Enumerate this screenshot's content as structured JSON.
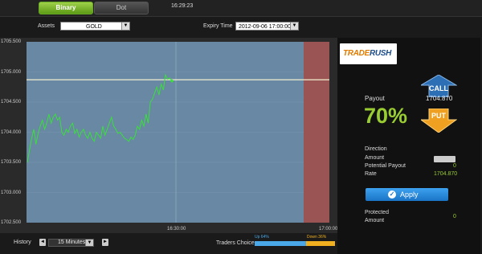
{
  "tabs": [
    {
      "label": "Binary",
      "active": true
    },
    {
      "label": "Dot",
      "active": false
    }
  ],
  "clock": "16:29:23",
  "filters": {
    "assets_label": "Assets",
    "asset_value": "GOLD",
    "expiry_label": "Expiry Time",
    "expiry_value": "2012-09-06 17:00:00"
  },
  "chart_data": {
    "type": "line",
    "y_ticks": [
      "1705.500",
      "1705.000",
      "1704.500",
      "1704.000",
      "1703.500",
      "1703.000",
      "1702.500"
    ],
    "x_ticks": [
      "16:30:00",
      "17:00:00"
    ],
    "ylim": [
      1702.5,
      1705.5
    ],
    "strike_price": 1704.87,
    "series": [
      {
        "values": [
          1703.5,
          1703.7,
          1703.9,
          1704.05,
          1703.8,
          1703.98,
          1704.1,
          1704.2,
          1704.05,
          1704.15,
          1704.3,
          1704.15,
          1704.25,
          1704.3,
          1704.2,
          1704.25,
          1704.0,
          1703.95,
          1704.05,
          1704.0,
          1704.1,
          1704.15,
          1703.98,
          1704.05,
          1703.92,
          1704.0,
          1704.05,
          1703.95,
          1703.9,
          1704.0,
          1703.9,
          1703.85,
          1704.0,
          1703.95,
          1703.9,
          1704.1,
          1703.95,
          1704.05,
          1704.15,
          1704.25,
          1704.1,
          1704.05,
          1703.98,
          1704.0,
          1703.95,
          1703.9,
          1703.88,
          1703.85,
          1703.92,
          1703.88,
          1703.95,
          1704.1,
          1704.05,
          1704.2,
          1704.1,
          1704.3,
          1704.15,
          1704.5,
          1704.55,
          1704.65,
          1704.75,
          1704.62,
          1704.8,
          1704.7,
          1704.95,
          1704.88,
          1704.9,
          1704.85
        ]
      }
    ]
  },
  "bottom": {
    "history_label": "History",
    "prev_arrow": "◄",
    "history_value": "15 Minutes",
    "next_arrow": "►",
    "traders_choice_label": "Traders Choice",
    "up_label": "Up 64%",
    "up_fraction": 0.64,
    "down_label": "Down 36%",
    "down_fraction": 0.36
  },
  "panel": {
    "brand": "TRADE",
    "brand_accent": "RUSH",
    "payout_label": "Payout",
    "payout_value": "70%",
    "current_price": "1704.870",
    "call_label": "CALL",
    "put_label": "PUT",
    "direction_label": "Direction",
    "amount_label": "Amount",
    "potential_payout_label": "Potential Payout",
    "potential_payout_value": "0",
    "rate_label": "Rate",
    "rate_value": "1704.870",
    "apply_label": "Apply",
    "protected_label": "Protected",
    "protected_amount_label": "Amount",
    "protected_amount_value": "0"
  },
  "colors": {
    "accent_green": "#9acd32",
    "call_blue": "#2c6fb5",
    "put_orange": "#f0a020",
    "chart_bg": "#6888a4",
    "expiry_zone": "#9a5454",
    "up_bar": "#4aa8e8",
    "down_bar": "#f0b020"
  }
}
